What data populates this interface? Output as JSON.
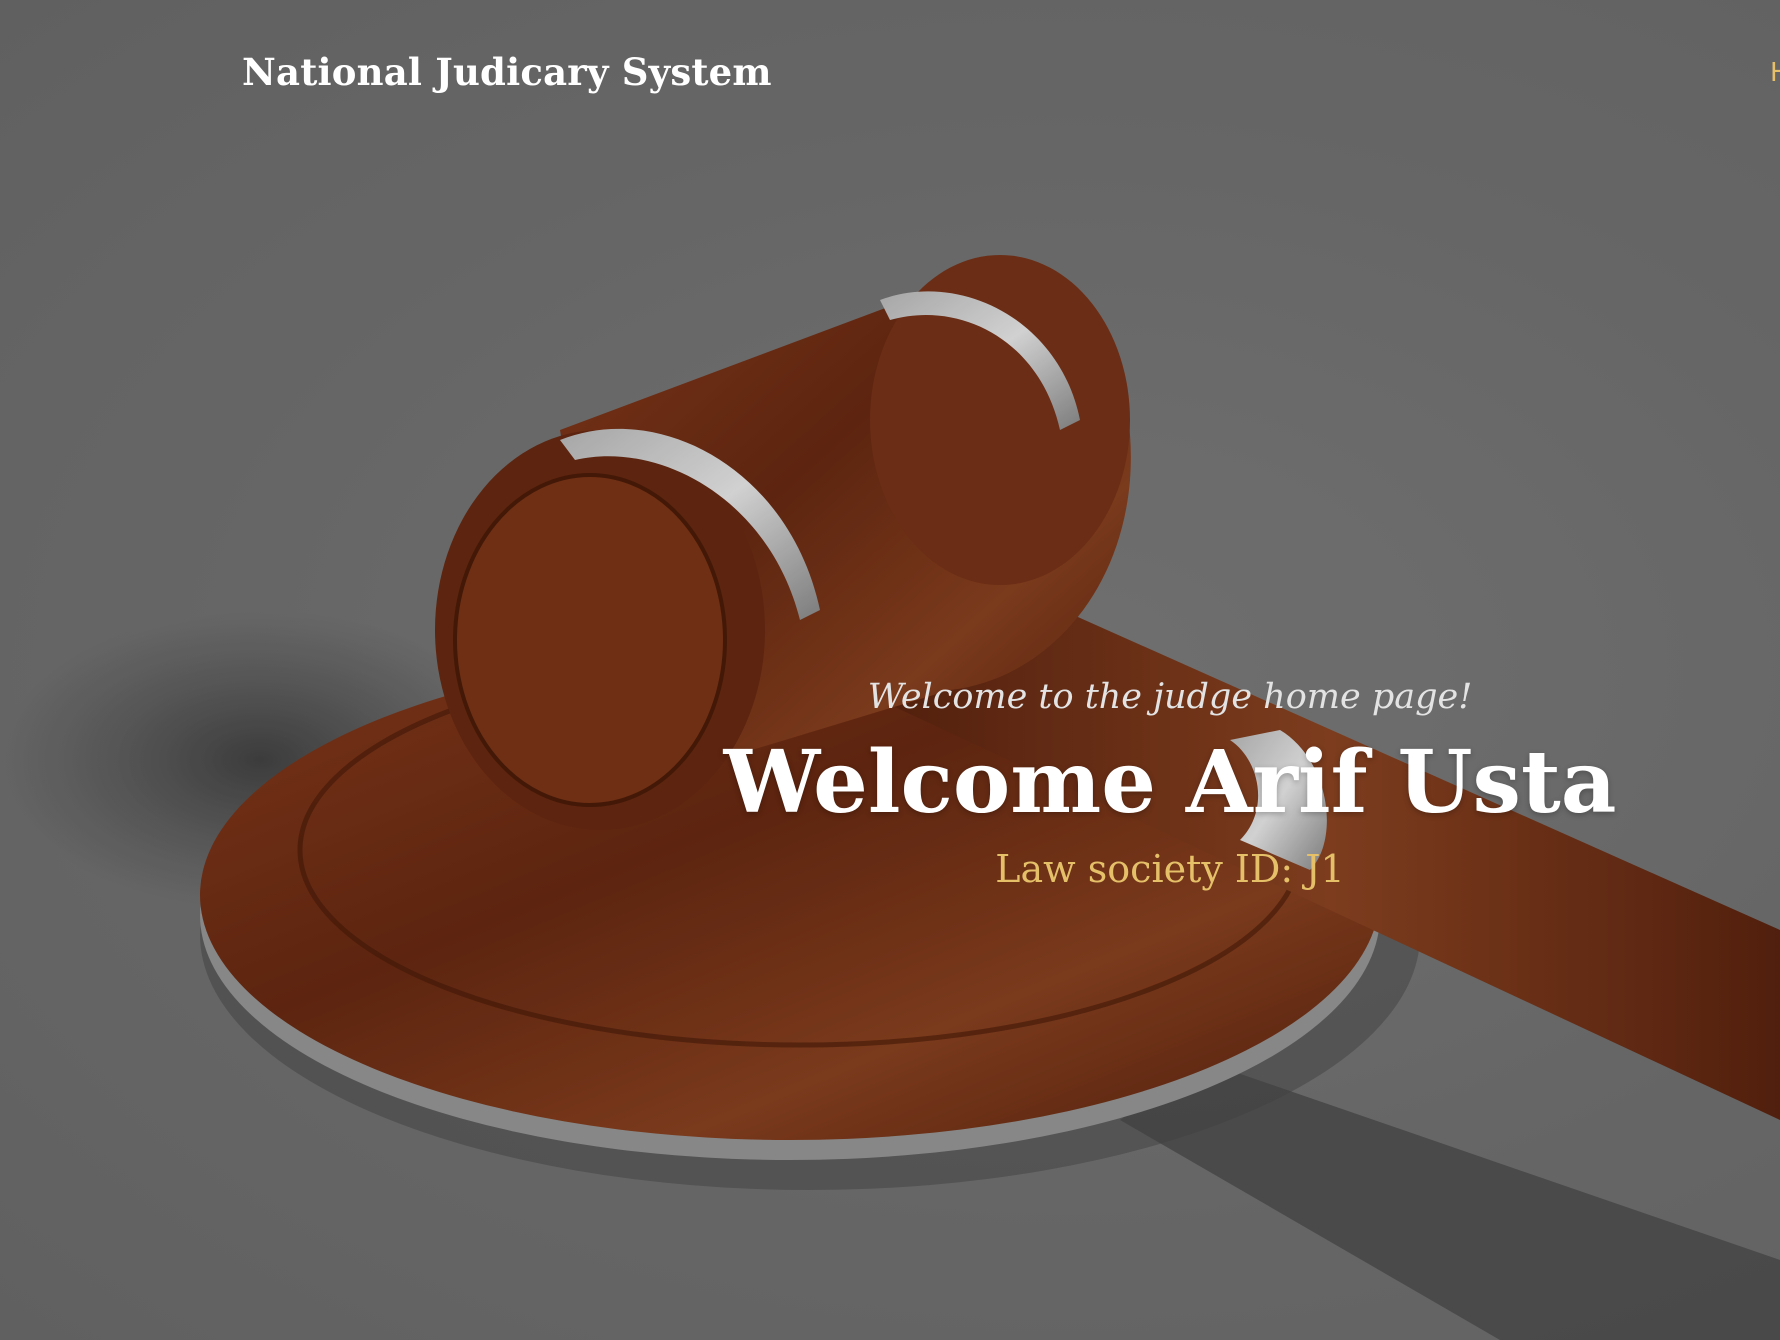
{
  "navbar": {
    "brand": "National Judicary System",
    "link_partial": "H"
  },
  "hero": {
    "subheading": "Welcome to the judge home page!",
    "heading": "Welcome Arif Usta",
    "id_line": "Law society ID: J1"
  },
  "colors": {
    "background": "#777777",
    "accent": "#e5c069",
    "wood": "#7a3418"
  }
}
